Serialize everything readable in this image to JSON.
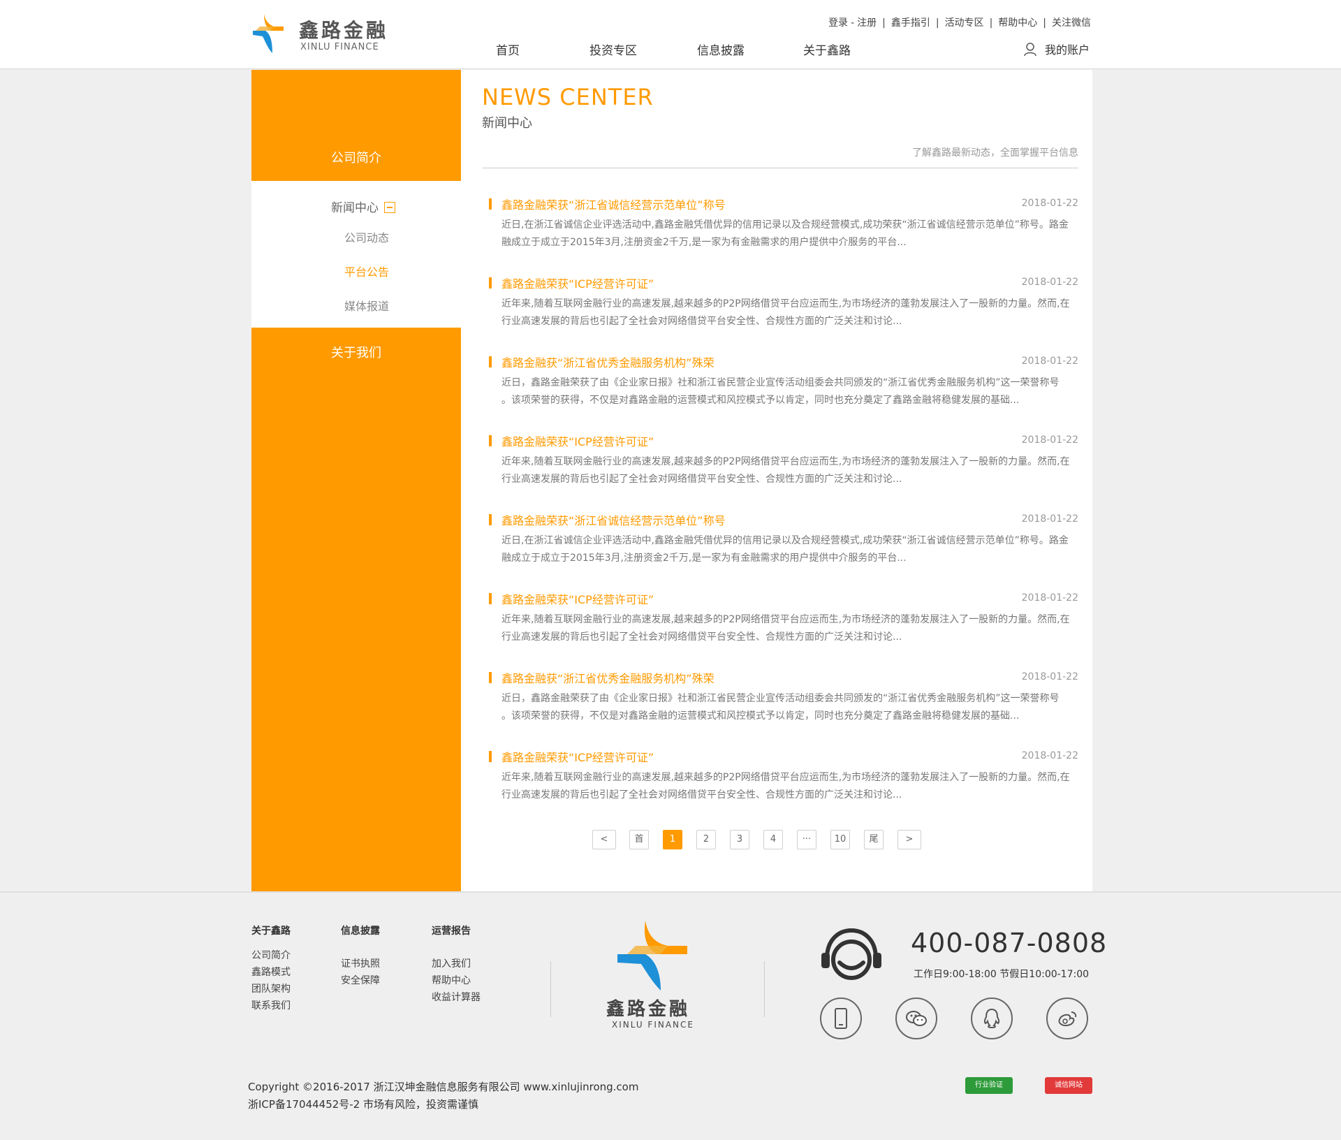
{
  "brand": {
    "name_cn": "鑫路金融",
    "name_en": "XINLU FINANCE",
    "colors": {
      "accent": "#ff9a00",
      "blue": "#1e90d8",
      "text": "#333333"
    }
  },
  "header": {
    "top_links": {
      "login": "登录",
      "dash": "-",
      "register": "注册",
      "guide": "鑫手指引",
      "events": "活动专区",
      "help": "帮助中心",
      "wechat": "关注微信"
    },
    "nav": [
      "首页",
      "投资专区",
      "信息披露",
      "关于鑫路"
    ],
    "account": "我的账户"
  },
  "sidebar": {
    "company_intro": "公司简介",
    "news_center": "新闻中心",
    "sub_items": [
      "公司动态",
      "平台公告",
      "媒体报道"
    ],
    "active_sub": "平台公告",
    "about_us": "关于我们"
  },
  "main": {
    "title_en": "NEWS CENTER",
    "title_cn": "新闻中心",
    "description": "了解鑫路最新动态，全面掌握平台信息",
    "news": [
      {
        "title": "鑫路金融荣获“浙江省诚信经营示范单位”称号",
        "date": "2018-01-22",
        "line1": "近日,在浙江省诚信企业评选活动中,鑫路金融凭借优异的信用记录以及合规经营模式,成功荣获“浙江省诚信经营示范单位”称号。路金",
        "line2": "融成立于成立于2015年3月,注册资金2千万,是一家为有金融需求的用户提供中介服务的平台..."
      },
      {
        "title": "鑫路金融荣获“ICP经营许可证”",
        "date": "2018-01-22",
        "line1": "近年来,随着互联网金融行业的高速发展,越来越多的P2P网络借贷平台应运而生,为市场经济的蓬勃发展注入了一股新的力量。然而,在",
        "line2": "行业高速发展的背后也引起了全社会对网络借贷平台安全性、合规性方面的广泛关注和讨论..."
      },
      {
        "title": "鑫路金融获“浙江省优秀金融服务机构”殊荣",
        "date": "2018-01-22",
        "line1": "近日，鑫路金融荣获了由《企业家日报》社和浙江省民营企业宣传活动组委会共同颁发的“浙江省优秀金融服务机构”这一荣誉称号",
        "line2": "。该项荣誉的获得，不仅是对鑫路金融的运营模式和风控模式予以肯定，同时也充分奠定了鑫路金融将稳健发展的基础..."
      },
      {
        "title": "鑫路金融荣获“ICP经营许可证”",
        "date": "2018-01-22",
        "line1": "近年来,随着互联网金融行业的高速发展,越来越多的P2P网络借贷平台应运而生,为市场经济的蓬勃发展注入了一股新的力量。然而,在",
        "line2": "行业高速发展的背后也引起了全社会对网络借贷平台安全性、合规性方面的广泛关注和讨论..."
      },
      {
        "title": "鑫路金融荣获“浙江省诚信经营示范单位”称号",
        "date": "2018-01-22",
        "line1": "近日,在浙江省诚信企业评选活动中,鑫路金融凭借优异的信用记录以及合规经营模式,成功荣获“浙江省诚信经营示范单位”称号。路金",
        "line2": "融成立于成立于2015年3月,注册资金2千万,是一家为有金融需求的用户提供中介服务的平台..."
      },
      {
        "title": "鑫路金融荣获“ICP经营许可证”",
        "date": "2018-01-22",
        "line1": "近年来,随着互联网金融行业的高速发展,越来越多的P2P网络借贷平台应运而生,为市场经济的蓬勃发展注入了一股新的力量。然而,在",
        "line2": "行业高速发展的背后也引起了全社会对网络借贷平台安全性、合规性方面的广泛关注和讨论..."
      },
      {
        "title": "鑫路金融获“浙江省优秀金融服务机构”殊荣",
        "date": "2018-01-22",
        "line1": "近日，鑫路金融荣获了由《企业家日报》社和浙江省民营企业宣传活动组委会共同颁发的“浙江省优秀金融服务机构”这一荣誉称号",
        "line2": "。该项荣誉的获得，不仅是对鑫路金融的运营模式和风控模式予以肯定，同时也充分奠定了鑫路金融将稳健发展的基础..."
      },
      {
        "title": "鑫路金融荣获“ICP经营许可证”",
        "date": "2018-01-22",
        "line1": "近年来,随着互联网金融行业的高速发展,越来越多的P2P网络借贷平台应运而生,为市场经济的蓬勃发展注入了一股新的力量。然而,在",
        "line2": "行业高速发展的背后也引起了全社会对网络借贷平台安全性、合规性方面的广泛关注和讨论..."
      }
    ],
    "pagination": {
      "prev": "<",
      "first": "首",
      "pages": [
        "1",
        "2",
        "3",
        "4"
      ],
      "ellipsis": "···",
      "last_page": "10",
      "last": "尾",
      "next": ">",
      "current": "1"
    }
  },
  "footer": {
    "col1": {
      "heading": "关于鑫路",
      "links": [
        "公司简介",
        "鑫路模式",
        "团队架构",
        "联系我们"
      ]
    },
    "col2": {
      "heading": "信息披露",
      "links": [
        "证书执照",
        "安全保障"
      ]
    },
    "col3": {
      "heading": "运营报告",
      "links": [
        "加入我们",
        "帮助中心",
        "收益计算器"
      ]
    },
    "logo_cn": "鑫路金融",
    "logo_en": "XINLU FINANCE",
    "phone": "400-087-0808",
    "hours": "工作日9:00-18:00  节假日10:00-17:00",
    "social_icons": [
      "mobile-icon",
      "wechat-icon",
      "qq-icon",
      "weibo-icon"
    ],
    "copyright": "Copyright ©2016-2017 浙江汉坤金融信息服务有限公司 www.xinlujinrong.com",
    "icp": "浙ICP备17044452号-2 市场有风险，投资需谨慎",
    "badge1": "行业验证",
    "badge2": "诚信网站"
  }
}
